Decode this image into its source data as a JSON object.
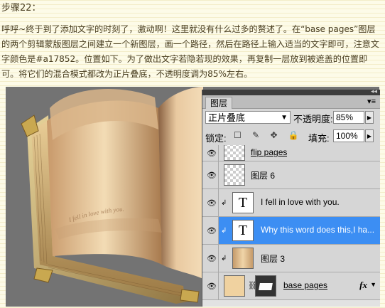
{
  "step": {
    "title": "步骤22：",
    "body": "呼呼~终于到了添加文字的时刻了，激动啊！这里就没有什么过多的赘述了。在“base pages”图层的两个剪辑蒙版图层之间建立一个新图层，画一个路径，然后在路径上输入适当的文字即可，注意文字颜色是#a17852。位置如下。为了做出文字若隐若现的效果，再复制一层放到被遮盖的位置即可。将它们的混合模式都改为正片叠底，不透明度调为85%左右。"
  },
  "book_text": "I fell in love with you.",
  "panel": {
    "tab_label": "图层",
    "tab_menu_icon": "panel-menu-icon",
    "blend_mode": "正片叠底",
    "opacity_label": "不透明度:",
    "opacity_value": "85%",
    "lock_label": "锁定:",
    "lock_icons": "☐ ✎ ✥ 🔒",
    "fill_label": "填充:",
    "fill_value": "100%",
    "layers": [
      {
        "name": "flip pages",
        "thumb": "checker",
        "selected": false,
        "clipped": false,
        "underline": true
      },
      {
        "name": "图层 6",
        "thumb": "checker",
        "selected": false,
        "clipped": false,
        "underline": false
      },
      {
        "name": "I fell in love with you.",
        "thumb": "text",
        "selected": false,
        "clipped": true,
        "underline": false
      },
      {
        "name": "Why this word does this,I ha...",
        "thumb": "text",
        "selected": true,
        "clipped": true,
        "underline": false
      },
      {
        "name": "图层 3",
        "thumb": "tan",
        "selected": false,
        "clipped": true,
        "underline": false
      },
      {
        "name": "base pages",
        "thumb": "base",
        "selected": false,
        "clipped": false,
        "underline": true,
        "fx": "fx"
      }
    ]
  },
  "colors": {
    "page_bg": "#fdfbe8",
    "text": "#4a3f22",
    "selection": "#3c8ef3",
    "canvas": "#737373"
  }
}
